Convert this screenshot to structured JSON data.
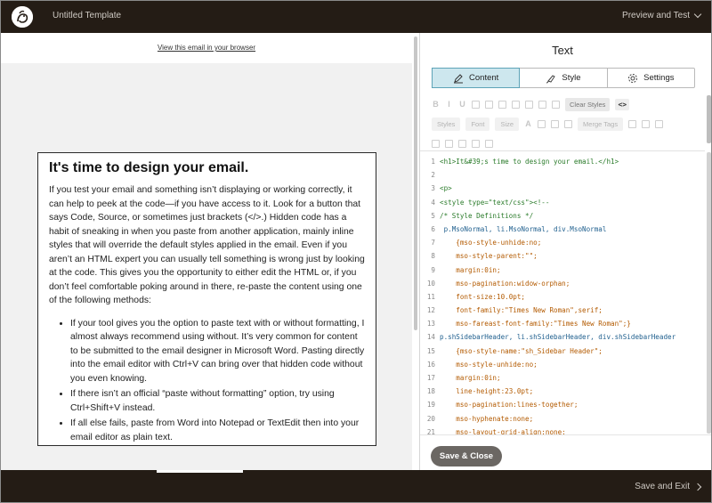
{
  "topbar": {
    "template_title": "Untitled Template",
    "preview_test": "Preview and Test"
  },
  "preview": {
    "view_in_browser": "View this email in your browser",
    "heading": "It's time to design your email.",
    "paragraph": "If you test your email and something isn’t displaying or working correctly, it can help to peek at the code—if you have access to it. Look for a button that says Code, Source, or sometimes just brackets (</>.) Hidden code has a habit of sneaking in when you paste from another application, mainly inline styles that will override the default styles applied in the email. Even if you aren’t an HTML expert you can usually tell something is wrong just by looking at the code. This gives you the opportunity to either edit the HTML or, if you don’t feel comfortable poking around in there, re-paste the content using one of the following methods:",
    "bullets": [
      "If your tool gives you the option to paste text with or without formatting, I almost always recommend using without. It’s very common for content to be submitted to the email designer in Microsoft Word. Pasting directly into the email editor with Ctrl+V can bring over that hidden code without you even knowing.",
      "If there isn’t an official “paste without formatting” option, try using Ctrl+Shift+V instead.",
      "If all else fails, paste from Word into Notepad or TextEdit then into your email editor as plain text."
    ]
  },
  "editor": {
    "title": "Text",
    "tabs": [
      {
        "label": "Content",
        "icon": "pencil-icon"
      },
      {
        "label": "Style",
        "icon": "paintbrush-icon"
      },
      {
        "label": "Settings",
        "icon": "gear-icon"
      }
    ],
    "toolbar": {
      "clear_styles": "Clear Styles",
      "code_toggle": "<>",
      "styles_drop": "Styles",
      "font_drop": "Font",
      "size_drop": "Size",
      "merge_tags": "Merge Tags"
    },
    "save_close": "Save & Close"
  },
  "code_lines": [
    {
      "n": "1",
      "t": "<h1>It&#39;s time to design your email.</h1>"
    },
    {
      "n": "2",
      "t": ""
    },
    {
      "n": "3",
      "t": "<p>"
    },
    {
      "n": "4",
      "t": "<style type=\"text/css\"><!--"
    },
    {
      "n": "5",
      "t": "/* Style Definitions */"
    },
    {
      "n": "6",
      "t": " p.MsoNormal, li.MsoNormal, div.MsoNormal"
    },
    {
      "n": "7",
      "t": "    {mso-style-unhide:no;"
    },
    {
      "n": "8",
      "t": "    mso-style-parent:\"\";"
    },
    {
      "n": "9",
      "t": "    margin:0in;"
    },
    {
      "n": "10",
      "t": "    mso-pagination:widow-orphan;"
    },
    {
      "n": "11",
      "t": "    font-size:10.0pt;"
    },
    {
      "n": "12",
      "t": "    font-family:\"Times New Roman\",serif;"
    },
    {
      "n": "13",
      "t": "    mso-fareast-font-family:\"Times New Roman\";}"
    },
    {
      "n": "14",
      "t": "p.shSidebarHeader, li.shSidebarHeader, div.shSidebarHeader"
    },
    {
      "n": "15",
      "t": "    {mso-style-name:\"sh_Sidebar Header\";"
    },
    {
      "n": "16",
      "t": "    mso-style-unhide:no;"
    },
    {
      "n": "17",
      "t": "    margin:0in;"
    },
    {
      "n": "18",
      "t": "    line-height:23.0pt;"
    },
    {
      "n": "19",
      "t": "    mso-pagination:lines-together;"
    },
    {
      "n": "20",
      "t": "    mso-hyphenate:none;"
    },
    {
      "n": "21",
      "t": "    mso-layout-grid-align:none;"
    }
  ],
  "bottombar": {
    "save_exit": "Save and Exit"
  },
  "colors": {
    "chrome": "#241c15",
    "active_tab": "#cde7ee",
    "save_close": "#6b6763"
  }
}
